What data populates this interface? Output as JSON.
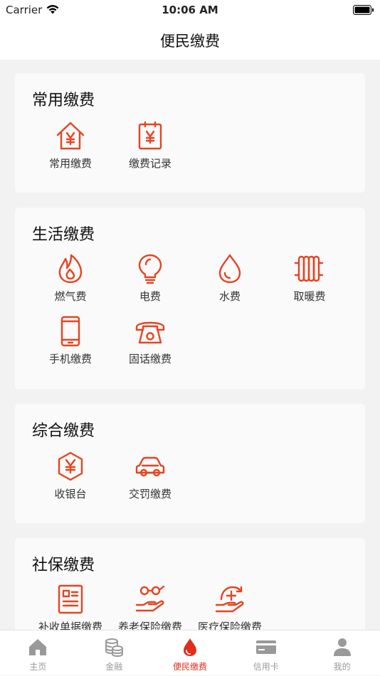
{
  "status_bar": {
    "carrier": "Carrier",
    "time": "10:06 AM"
  },
  "header": {
    "title": "便民缴费"
  },
  "sections": [
    {
      "title": "常用缴费",
      "items": [
        {
          "label": "常用缴费",
          "icon": "house-yen-icon"
        },
        {
          "label": "缴费记录",
          "icon": "clipboard-yen-icon"
        }
      ]
    },
    {
      "title": "生活缴费",
      "items": [
        {
          "label": "燃气费",
          "icon": "flame-icon"
        },
        {
          "label": "电费",
          "icon": "lightbulb-icon"
        },
        {
          "label": "水费",
          "icon": "water-drop-icon"
        },
        {
          "label": "取暖费",
          "icon": "radiator-icon"
        },
        {
          "label": "手机缴费",
          "icon": "mobile-phone-icon"
        },
        {
          "label": "固话缴费",
          "icon": "telephone-icon"
        }
      ]
    },
    {
      "title": "综合缴费",
      "items": [
        {
          "label": "收银台",
          "icon": "hexagon-yen-icon"
        },
        {
          "label": "交罚缴费",
          "icon": "car-icon"
        }
      ]
    },
    {
      "title": "社保缴费",
      "items": [
        {
          "label": "补收单据缴费",
          "icon": "document-icon"
        },
        {
          "label": "养老保险缴费",
          "icon": "elderly-care-icon"
        },
        {
          "label": "医疗保险缴费",
          "icon": "medical-insurance-icon"
        }
      ]
    }
  ],
  "tab_bar": {
    "active_index": 2,
    "tabs": [
      {
        "label": "主页",
        "icon": "home-icon"
      },
      {
        "label": "金融",
        "icon": "coins-icon"
      },
      {
        "label": "便民缴费",
        "icon": "drop-icon"
      },
      {
        "label": "信用卡",
        "icon": "credit-card-icon"
      },
      {
        "label": "我的",
        "icon": "user-icon"
      }
    ]
  },
  "colors": {
    "accent": "#e8431f",
    "tab_inactive": "#999999",
    "tab_active": "#e02e1b"
  }
}
